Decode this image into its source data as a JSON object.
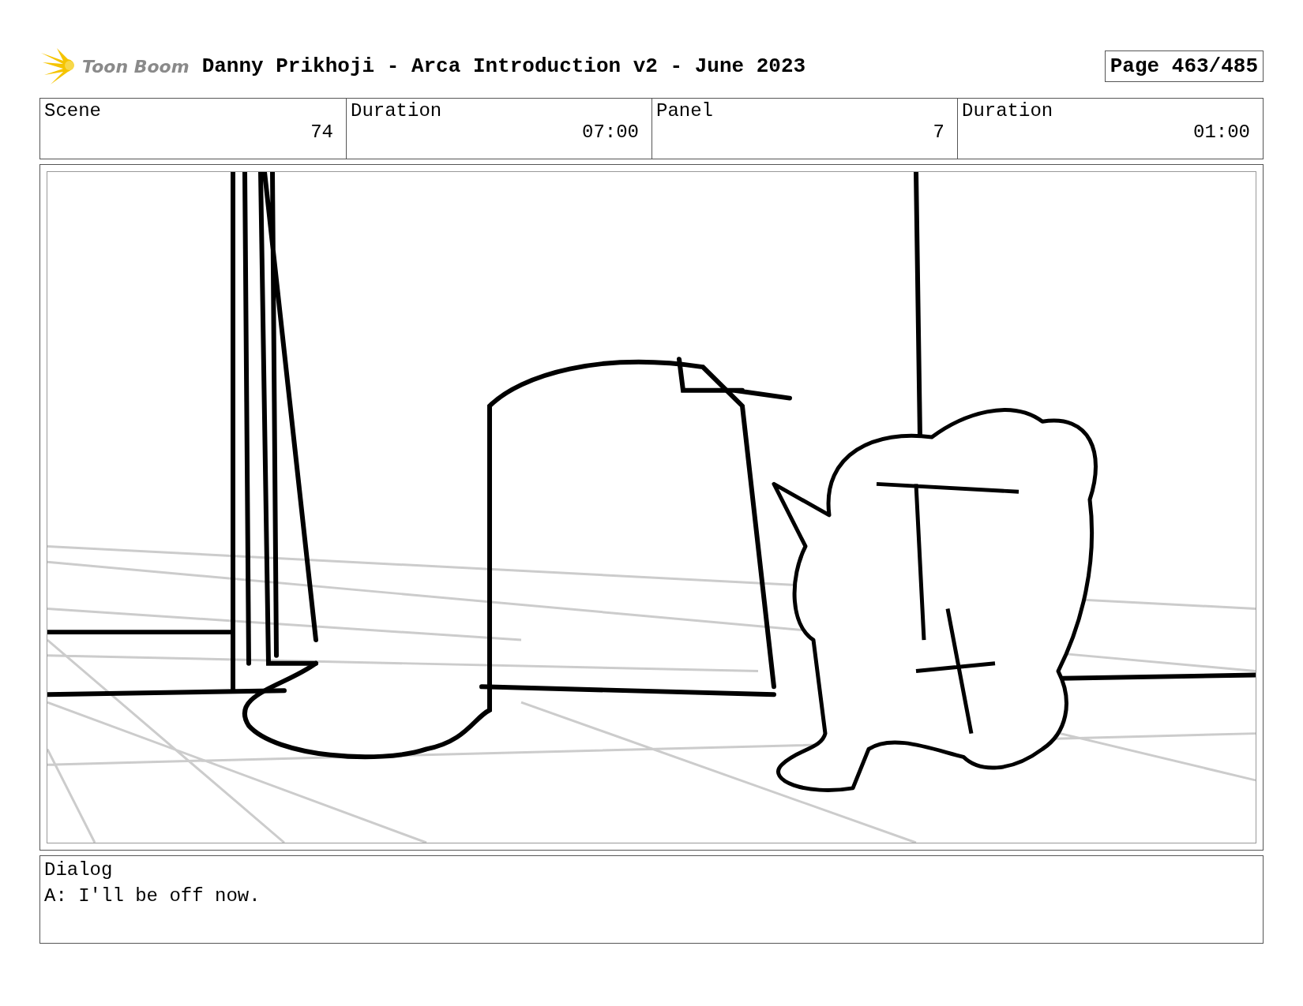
{
  "header": {
    "logo": "Toon Boom",
    "title": "Danny Prikhoji - Arca Introduction v2 - June 2023",
    "page": "Page 463/485"
  },
  "fields": [
    {
      "label": "Scene",
      "value": "74"
    },
    {
      "label": "Duration",
      "value": "07:00"
    },
    {
      "label": "Panel",
      "value": "7"
    },
    {
      "label": "Duration",
      "value": "01:00"
    }
  ],
  "dialog": {
    "label": "Dialog",
    "text": "A: I'll be off now."
  }
}
